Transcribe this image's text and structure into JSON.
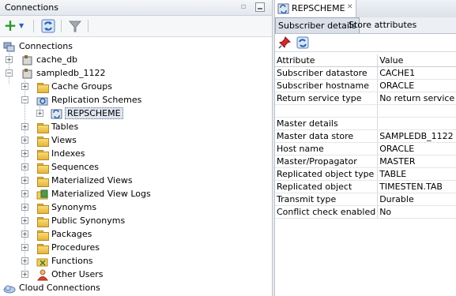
{
  "left_panel": {
    "title": "Connections",
    "toolbar": {
      "add_icon": "plus-icon",
      "dropdown_icon": "chevron-down-icon",
      "refresh_icon": "refresh-icon",
      "filter_icon": "filter-icon"
    },
    "tree": {
      "connections": "Connections",
      "cache_db": "cache_db",
      "sampledb": "sampledb_1122",
      "cache_groups": "Cache Groups",
      "replication_schemes": "Replication Schemes",
      "repscheme": "REPSCHEME",
      "tables": "Tables",
      "views": "Views",
      "indexes": "Indexes",
      "sequences": "Sequences",
      "materialized_views": "Materialized Views",
      "materialized_view_logs": "Materialized View Logs",
      "synonyms": "Synonyms",
      "public_synonyms": "Public Synonyms",
      "packages": "Packages",
      "procedures": "Procedures",
      "functions": "Functions",
      "other_users": "Other Users",
      "cloud_connections": "Cloud Connections"
    }
  },
  "right_panel": {
    "doc_tab": "REPSCHEME",
    "subtabs": [
      "Subscriber details",
      "Store attributes"
    ],
    "table": {
      "headers": [
        "Attribute",
        "Value"
      ],
      "rows": [
        [
          "Subscriber datastore",
          "CACHE1"
        ],
        [
          "Subscriber hostname",
          "ORACLE"
        ],
        [
          "Return service type",
          "No return service"
        ],
        [
          "",
          ""
        ],
        [
          "Master details",
          ""
        ],
        [
          "Master data store",
          "SAMPLEDB_1122"
        ],
        [
          "Host name",
          "ORACLE"
        ],
        [
          "Master/Propagator",
          "MASTER"
        ],
        [
          "Replicated object type",
          "TABLE"
        ],
        [
          "Replicated object",
          "TIMESTEN.TAB"
        ],
        [
          "Transmit type",
          "Durable"
        ],
        [
          "Conflict check enabled",
          "No"
        ]
      ]
    }
  },
  "colors": {
    "selection": "#dfe6f1",
    "folder": "#e5b53c",
    "add_green": "#2b9a2b",
    "pin_red": "#d22a2a"
  }
}
